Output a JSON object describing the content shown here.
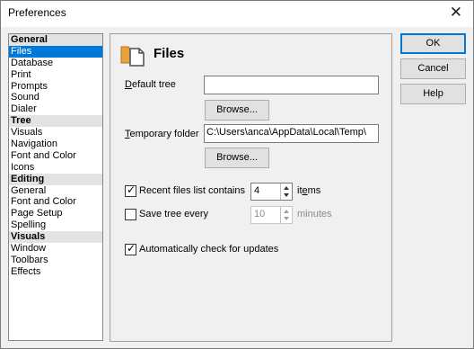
{
  "window": {
    "title": "Preferences",
    "close_glyph": "✕"
  },
  "nav": {
    "items": [
      {
        "label": "General",
        "type": "header"
      },
      {
        "label": "Files",
        "type": "selected"
      },
      {
        "label": "Database",
        "type": "item"
      },
      {
        "label": "Print",
        "type": "item"
      },
      {
        "label": "Prompts",
        "type": "item"
      },
      {
        "label": "Sound",
        "type": "item"
      },
      {
        "label": "Dialer",
        "type": "item"
      },
      {
        "label": "Tree",
        "type": "header"
      },
      {
        "label": "Visuals",
        "type": "item"
      },
      {
        "label": "Navigation",
        "type": "item"
      },
      {
        "label": "Font and Color",
        "type": "item"
      },
      {
        "label": "Icons",
        "type": "item"
      },
      {
        "label": "Editing",
        "type": "header"
      },
      {
        "label": "General",
        "type": "item"
      },
      {
        "label": "Font and Color",
        "type": "item"
      },
      {
        "label": "Page Setup",
        "type": "item"
      },
      {
        "label": "Spelling",
        "type": "item"
      },
      {
        "label": "Visuals",
        "type": "header"
      },
      {
        "label": "Window",
        "type": "item"
      },
      {
        "label": "Toolbars",
        "type": "item"
      },
      {
        "label": "Effects",
        "type": "item"
      }
    ]
  },
  "panel": {
    "title": "Files",
    "default_tree": {
      "label_pre": "",
      "label_u": "D",
      "label_post": "efault tree",
      "value": "",
      "browse": "Browse..."
    },
    "temp_folder": {
      "label_pre": "",
      "label_u": "T",
      "label_post": "emporary folder",
      "value": "C:\\Users\\anca\\AppData\\Local\\Temp\\",
      "browse": "Browse..."
    },
    "recent_files": {
      "checked": true,
      "label": "Recent files list contains",
      "value": "4",
      "unit_pre": "it",
      "unit_u": "e",
      "unit_post": "ms"
    },
    "save_tree": {
      "checked": false,
      "label": "Save tree every",
      "value": "10",
      "unit": "minutes"
    },
    "auto_update": {
      "checked": true,
      "label": "Automatically check for updates"
    }
  },
  "buttons": {
    "ok": "OK",
    "cancel": "Cancel",
    "help": "Help"
  },
  "colors": {
    "selection": "#0078d7",
    "header_bg": "#e3e3e3"
  },
  "icons": {
    "panel_icon": "folder-document-icon",
    "close": "close-icon"
  }
}
